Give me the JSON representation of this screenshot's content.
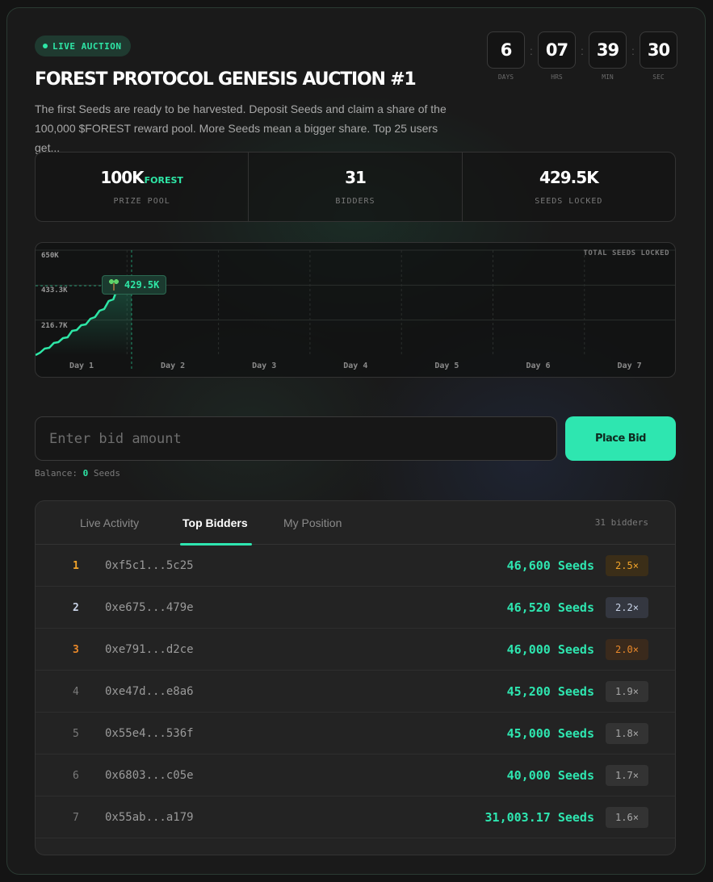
{
  "header": {
    "badge": "LIVE AUCTION",
    "title": "FOREST PROTOCOL GENESIS AUCTION #1",
    "description": "The first Seeds are ready to be harvested. Deposit Seeds and claim a share of the 100,000 $FOREST reward pool. More Seeds mean a bigger share. Top 25 users get..."
  },
  "countdown": [
    {
      "value": "6",
      "label": "DAYS"
    },
    {
      "value": "07",
      "label": "HRS"
    },
    {
      "value": "39",
      "label": "MIN"
    },
    {
      "value": "30",
      "label": "SEC"
    }
  ],
  "stats": [
    {
      "value": "100K",
      "unit": "FOREST",
      "label": "PRIZE POOL"
    },
    {
      "value": "31",
      "unit": "",
      "label": "BIDDERS"
    },
    {
      "value": "429.5K",
      "unit": "",
      "label": "SEEDS LOCKED"
    }
  ],
  "chart_data": {
    "type": "area",
    "title": "TOTAL SEEDS LOCKED",
    "y_tick_labels": [
      "650K",
      "433.3K",
      "216.7K"
    ],
    "ylim": [
      0,
      650000
    ],
    "x_tick_labels": [
      "Day 1",
      "Day 2",
      "Day 3",
      "Day 4",
      "Day 5",
      "Day 6",
      "Day 7"
    ],
    "x_unit": "days",
    "x": [
      0,
      0.05,
      0.1,
      0.15,
      0.2,
      0.25,
      0.3,
      0.35,
      0.4,
      0.45,
      0.5,
      0.55,
      0.6,
      0.65,
      0.7,
      0.75,
      0.8,
      0.85,
      0.9,
      0.95,
      1.0,
      1.05
    ],
    "y": [
      0,
      15000,
      40000,
      45000,
      75000,
      80000,
      105000,
      110000,
      150000,
      155000,
      185000,
      190000,
      225000,
      235000,
      275000,
      285000,
      335000,
      345000,
      420000,
      425000,
      428000,
      429500
    ],
    "current_label": "429.5K",
    "current_icon": "sprout-icon",
    "accent_color": "#2ee6a6"
  },
  "bid": {
    "placeholder": "Enter bid amount",
    "button_label": "Place Bid",
    "balance_label": "Balance:",
    "balance_value": "0",
    "balance_unit": "Seeds"
  },
  "panel": {
    "tabs": [
      "Live Activity",
      "Top Bidders",
      "My Position"
    ],
    "active_tab": "Top Bidders",
    "bidder_count": "31 bidders",
    "rows": [
      {
        "rank": "1",
        "address": "0xf5c1...5c25",
        "amount": "46,600 Seeds",
        "multiplier": "2.5×"
      },
      {
        "rank": "2",
        "address": "0xe675...479e",
        "amount": "46,520 Seeds",
        "multiplier": "2.2×"
      },
      {
        "rank": "3",
        "address": "0xe791...d2ce",
        "amount": "46,000 Seeds",
        "multiplier": "2.0×"
      },
      {
        "rank": "4",
        "address": "0xe47d...e8a6",
        "amount": "45,200 Seeds",
        "multiplier": "1.9×"
      },
      {
        "rank": "5",
        "address": "0x55e4...536f",
        "amount": "45,000 Seeds",
        "multiplier": "1.8×"
      },
      {
        "rank": "6",
        "address": "0x6803...c05e",
        "amount": "40,000 Seeds",
        "multiplier": "1.7×"
      },
      {
        "rank": "7",
        "address": "0x55ab...a179",
        "amount": "31,003.17 Seeds",
        "multiplier": "1.6×"
      }
    ]
  }
}
